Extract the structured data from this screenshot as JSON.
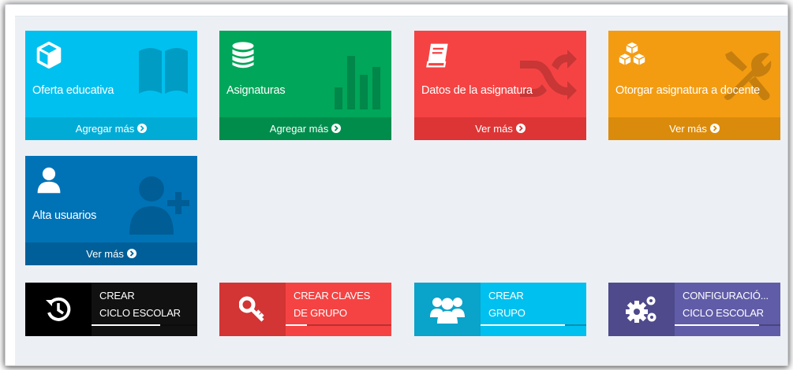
{
  "boxes": [
    {
      "label": "Oferta educativa",
      "footer": "Agregar más",
      "icon": "cube-icon",
      "bg_icon": "book-icon",
      "color": "#00c0ef",
      "footer_color": "#00acd6"
    },
    {
      "label": "Asignaturas",
      "footer": "Agregar más",
      "icon": "database-icon",
      "bg_icon": "bar-chart-icon",
      "color": "#00a65a",
      "footer_color": "#008d4c"
    },
    {
      "label": "Datos de la asignatura",
      "footer": "Ver más",
      "icon": "book-icon",
      "bg_icon": "shuffle-icon",
      "color": "#f54343",
      "footer_color": "#dd3535"
    },
    {
      "label": "Otorgar asignatura a docente",
      "footer": "Ver más",
      "icon": "cubes-icon",
      "bg_icon": "wrench-icon",
      "color": "#f39c12",
      "footer_color": "#db8b0b"
    },
    {
      "label": "Alta usuarios",
      "footer": "Ver más",
      "icon": "user-icon",
      "bg_icon": "user-plus-icon",
      "color": "#0073b7",
      "footer_color": "#005f98"
    }
  ],
  "buttons": [
    {
      "line1": "CREAR",
      "line2": "CICLO ESCOLAR",
      "icon": "history-icon",
      "progress": 0.65,
      "color": "#111111",
      "icon_color": "#000000"
    },
    {
      "line1": "CREAR CLAVES",
      "line2": "DE GRUPO",
      "icon": "key-icon",
      "progress": 0.2,
      "color": "#f54343",
      "icon_color": "#d33434"
    },
    {
      "line1": "CREAR",
      "line2": "GRUPO",
      "icon": "users-icon",
      "progress": 0.8,
      "color": "#00c0ef",
      "icon_color": "#0aa3c9"
    },
    {
      "line1": "CONFIGURACIÓ...",
      "line2": "CICLO ESCOLAR",
      "icon": "gears-icon",
      "progress": 0.8,
      "color": "#605ca8",
      "icon_color": "#4e4a8c"
    }
  ]
}
